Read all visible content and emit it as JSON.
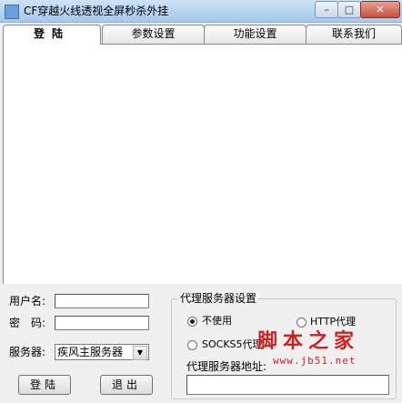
{
  "window": {
    "title": "CF穿越火线透视全屏秒杀外挂"
  },
  "controls": {
    "minimize": "–",
    "maximize": "□",
    "close": "✕"
  },
  "tabs": [
    {
      "label": "登陆",
      "active": true
    },
    {
      "label": "参数设置",
      "active": false
    },
    {
      "label": "功能设置",
      "active": false
    },
    {
      "label": "联系我们",
      "active": false
    }
  ],
  "login": {
    "username_label": "用户名:",
    "username_value": "",
    "password_label": "密　码:",
    "password_value": "",
    "server_label": "服务器:",
    "server_selected": "疾风主服务器",
    "login_button": "登陆",
    "exit_button": "退出"
  },
  "proxy": {
    "group_title": "代理服务器设置",
    "options": [
      {
        "label": "不使用",
        "selected": true
      },
      {
        "label": "HTTP代理",
        "selected": false
      },
      {
        "label": "SOCKS5代理",
        "selected": false
      }
    ],
    "address_label": "代理服务器地址:",
    "address_value": ""
  },
  "watermark": {
    "text": "脚本之家",
    "url": "www.jb51.net",
    "color": "#d21f1f"
  }
}
